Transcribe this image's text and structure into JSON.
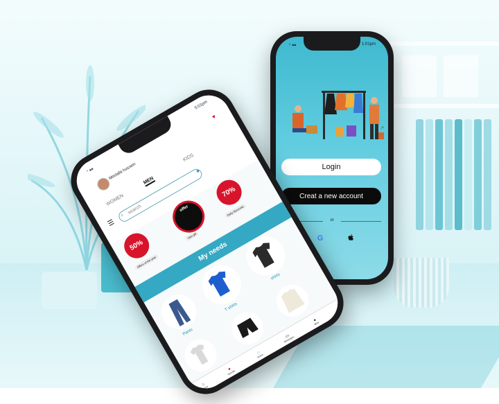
{
  "login_screen": {
    "status_time": "1:01pm",
    "login_label": "Login",
    "create_account_label": "Creat a new account",
    "or_label": "or",
    "google_icon": "google-icon",
    "apple_icon": "apple-icon"
  },
  "shop_screen": {
    "status_time": "5:01pm",
    "user_name": "Mostafa hussein",
    "search_placeholder": "search",
    "tabs": [
      {
        "label": "WOMEN",
        "active": false
      },
      {
        "label": "MEN",
        "active": true
      },
      {
        "label": "KIDS",
        "active": false
      }
    ],
    "badges": {
      "left_percent": "50%",
      "right_percent": "70%",
      "center_label": "offer"
    },
    "offers": [
      {
        "label": "Offers of the year"
      },
      {
        "label": "Vips gift"
      },
      {
        "label": "Daily discounts"
      }
    ],
    "section_title": "My needs",
    "products": [
      {
        "label": "Pants"
      },
      {
        "label": "T shirts"
      },
      {
        "label": "shirts"
      }
    ],
    "nav": [
      {
        "label": "Home"
      },
      {
        "label": "favorite"
      },
      {
        "label": "Home"
      },
      {
        "label": "Messages"
      },
      {
        "label": "Mine"
      }
    ],
    "colors": {
      "accent": "#35a9c3",
      "badge_red": "#d7142b"
    }
  }
}
